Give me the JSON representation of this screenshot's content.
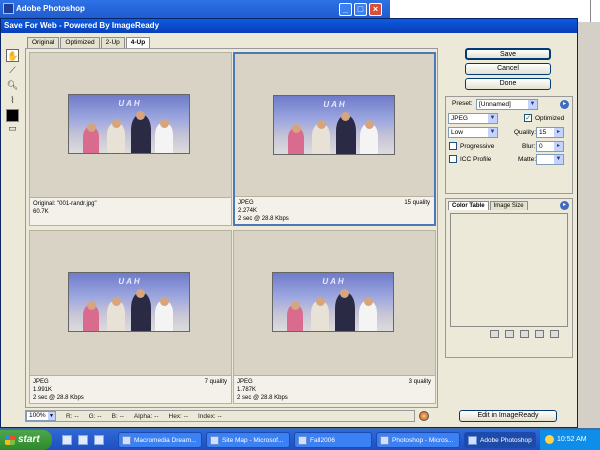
{
  "photoshop": {
    "title": "Adobe Photoshop"
  },
  "dialog": {
    "title": "Save For Web - Powered By ImageReady",
    "tabs": [
      "Original",
      "Optimized",
      "2-Up",
      "4-Up"
    ],
    "active_tab": "4-Up"
  },
  "panes": [
    {
      "line1": "Original: \"001-randr.jpg\"",
      "line2": "60.7K",
      "line3": "",
      "quality": ""
    },
    {
      "line1": "JPEG",
      "line2": "2.274K",
      "line3": "2 sec @ 28.8 Kbps",
      "quality": "15 quality"
    },
    {
      "line1": "JPEG",
      "line2": "1.991K",
      "line3": "2 sec @ 28.8 Kbps",
      "quality": "7 quality"
    },
    {
      "line1": "JPEG",
      "line2": "1.787K",
      "line3": "2 sec @ 28.8 Kbps",
      "quality": "3 quality"
    }
  ],
  "image": {
    "banner": "UAH"
  },
  "buttons": {
    "save": "Save",
    "cancel": "Cancel",
    "done": "Done",
    "edit_imageready": "Edit in ImageReady"
  },
  "settings": {
    "preset_label": "Preset:",
    "preset_value": "[Unnamed]",
    "format": "JPEG",
    "compression": "Low",
    "optimized_label": "Optimized",
    "quality_label": "Quality:",
    "quality_value": "15",
    "progressive_label": "Progressive",
    "blur_label": "Blur:",
    "blur_value": "0",
    "icc_label": "ICC Profile",
    "matte_label": "Matte:"
  },
  "color_panel": {
    "tabs": [
      "Color Table",
      "Image Size"
    ],
    "active_tab": "Color Table"
  },
  "statusbar": {
    "zoom": "100%",
    "items": [
      "R: --",
      "G: --",
      "B: --",
      "Alpha: --",
      "Hex: --",
      "Index: --"
    ]
  },
  "taskbar": {
    "start": "start",
    "buttons": [
      "Macromedia Dream...",
      "Site Map - Microsof...",
      "Fall2006",
      "Photoshop - Micros...",
      "Adobe Photoshop"
    ],
    "active": "Adobe Photoshop",
    "clock": "10:52 AM"
  },
  "colors": {
    "accent": "#0a5fe0",
    "selected_pane_border": "#4a78b8",
    "taskbar": "#245edb"
  }
}
